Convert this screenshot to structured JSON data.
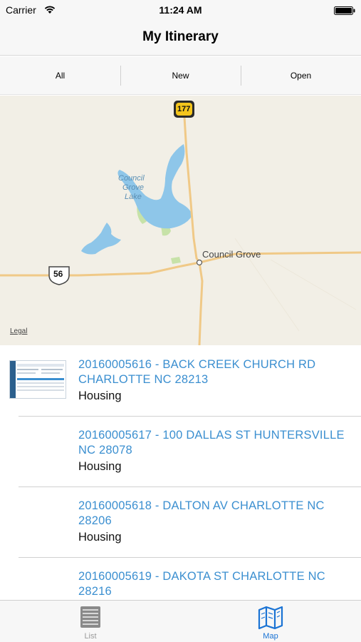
{
  "status_bar": {
    "carrier": "Carrier",
    "time": "11:24 AM",
    "icons": [
      "wifi-icon",
      "battery-icon"
    ]
  },
  "nav": {
    "title": "My Itinerary"
  },
  "filters": [
    {
      "label": "All"
    },
    {
      "label": "New"
    },
    {
      "label": "Open"
    }
  ],
  "map": {
    "lake_label_line1": "Council",
    "lake_label_line2": "Grove",
    "lake_label_line3": "Lake",
    "town_label": "Council Grove",
    "route_177": "177",
    "route_56": "56",
    "legal": "Legal"
  },
  "itinerary": [
    {
      "title": "20160005616 - BACK CREEK CHURCH RD CHARLOTTE NC 28213",
      "type": "Housing",
      "has_thumbnail": true
    },
    {
      "title": "20160005617 - 100 DALLAS ST HUNTERSVILLE NC 28078",
      "type": "Housing",
      "has_thumbnail": false
    },
    {
      "title": "20160005618 - DALTON AV CHARLOTTE NC 28206",
      "type": "Housing",
      "has_thumbnail": false
    },
    {
      "title": "20160005619 - DAKOTA ST CHARLOTTE NC 28216",
      "type": "",
      "has_thumbnail": false
    }
  ],
  "tab_bar": {
    "list_label": "List",
    "map_label": "Map",
    "list_icon": "list-icon",
    "map_icon": "map-icon",
    "inactive_color": "#9a9a9a",
    "active_color": "#1a73d4"
  },
  "colors": {
    "link": "#3b8fd0",
    "water": "#8ec6e9",
    "road": "#f0c987"
  }
}
